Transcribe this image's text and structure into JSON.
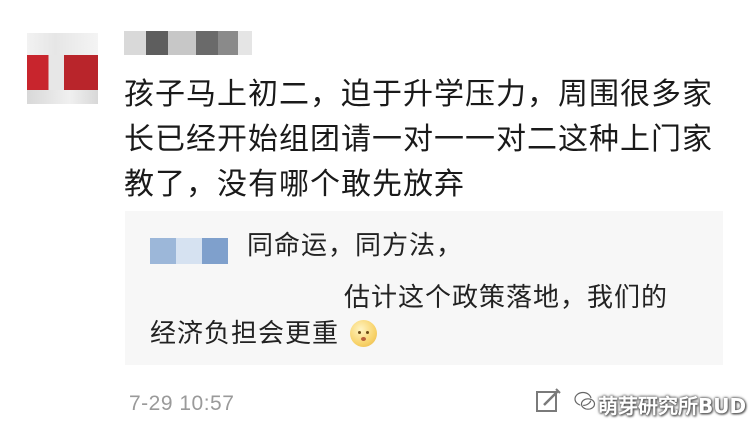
{
  "comment": {
    "text": "孩子马上初二，迫于升学压力，周围很多家长已经开始组团请一对一一对二这种上门家教了，没有哪个敢先放弃",
    "timestamp": "7-29 10:57"
  },
  "reply": {
    "line1": "同命运，同方法，",
    "line2": "估计这个政策落地，我们的",
    "line3": "经济负担会更重",
    "emoji": "confused-face"
  },
  "watermark": {
    "text": "萌芽研究所BUD",
    "icon": "wechat-icon"
  },
  "colors": {
    "avatar_red": "#c8252d",
    "reply_bg": "#f7f7f7",
    "timestamp": "#9a9a9a"
  }
}
